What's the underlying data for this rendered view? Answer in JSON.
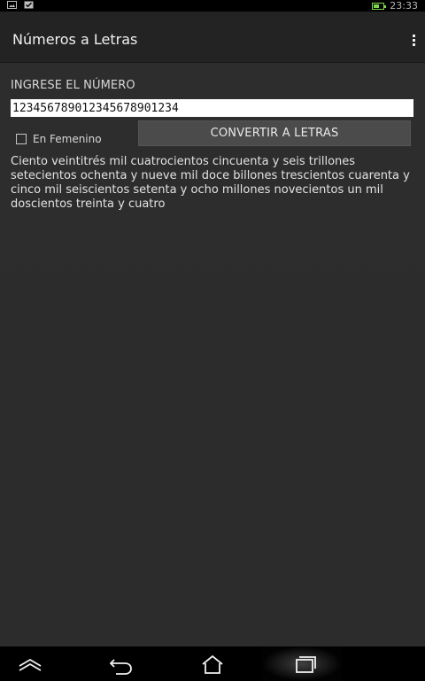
{
  "status_bar": {
    "time": "23:33",
    "icons": [
      "image-icon",
      "check-icon",
      "battery-icon"
    ],
    "battery_level": 0.6,
    "battery_color": "#7bd84e"
  },
  "action_bar": {
    "title": "Números a Letras",
    "overflow_icon": "more-vert-icon"
  },
  "form": {
    "label": "INGRESE EL NÚMERO",
    "number_value": "1234567890123456789012 34",
    "number_value_clean": "123456789012345678901234",
    "checkbox_label": "En Femenino",
    "checkbox_checked": false,
    "button_label": "CONVERTIR A LETRAS"
  },
  "result": {
    "text": "Ciento veintitrés mil cuatrocientos cincuenta y seis trillones setecientos ochenta y nueve mil doce  billones trescientos cuarenta y cinco mil seiscientos setenta y ocho millones novecientos un mil doscientos treinta y cuatro"
  },
  "navigation": {
    "items": [
      "up-icon",
      "back-icon",
      "home-icon",
      "recent-apps-icon"
    ]
  },
  "colors": {
    "background": "#2c2c2c",
    "actionbar": "#232323",
    "button": "#4b4b4b",
    "text": "#e2e2e2"
  }
}
